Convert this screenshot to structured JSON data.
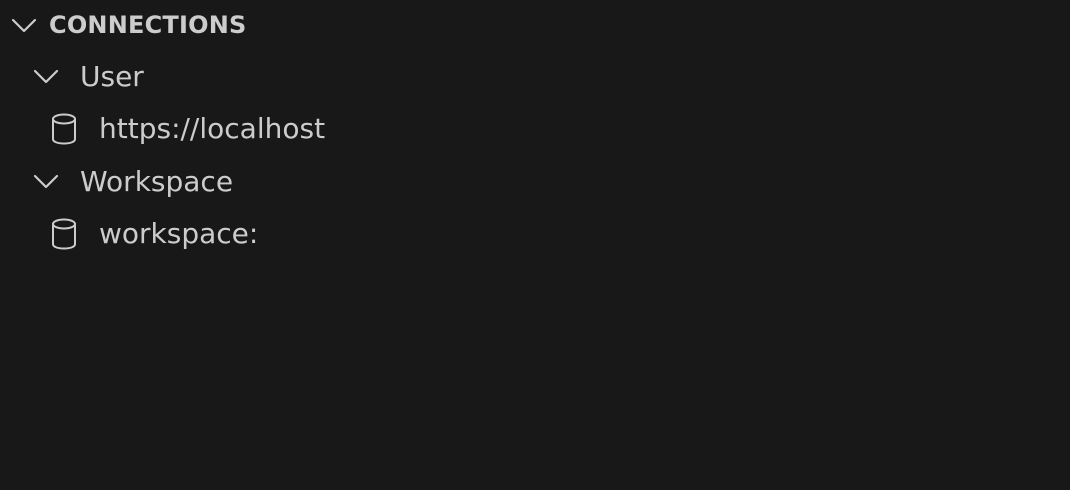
{
  "section": {
    "title": "CONNECTIONS"
  },
  "groups": [
    {
      "label": "User",
      "items": [
        {
          "label": "https://localhost",
          "icon": "database-icon"
        }
      ]
    },
    {
      "label": "Workspace",
      "items": [
        {
          "label": "workspace:",
          "icon": "database-icon"
        }
      ]
    }
  ],
  "icons": {
    "section_chevron": "chevron-down-icon",
    "group_chevron": "chevron-down-icon"
  },
  "colors": {
    "background": "#181818",
    "foreground": "#cccccc"
  }
}
